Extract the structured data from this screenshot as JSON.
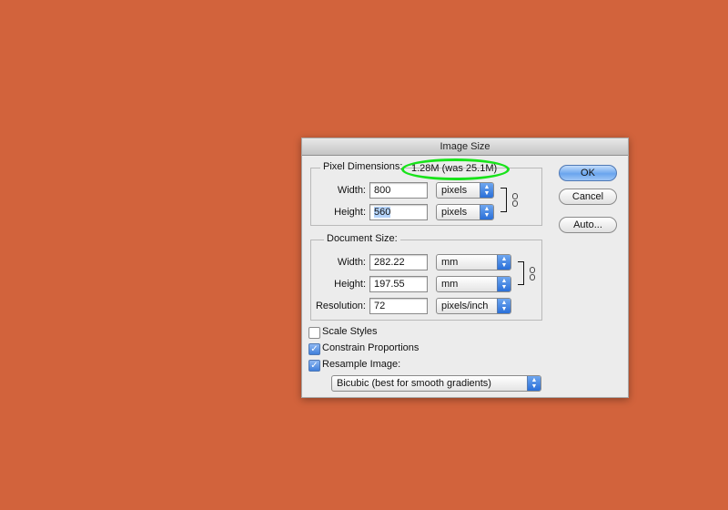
{
  "dialog": {
    "title": "Image Size"
  },
  "pixel_dimensions": {
    "legend": "Pixel Dimensions:",
    "size_text": "1.28M (was 25.1M)",
    "width_label": "Width:",
    "width_value": "800",
    "width_unit": "pixels",
    "height_label": "Height:",
    "height_value": "560",
    "height_unit": "pixels"
  },
  "document_size": {
    "legend": "Document Size:",
    "width_label": "Width:",
    "width_value": "282.22",
    "width_unit": "mm",
    "height_label": "Height:",
    "height_value": "197.55",
    "height_unit": "mm",
    "resolution_label": "Resolution:",
    "resolution_value": "72",
    "resolution_unit": "pixels/inch"
  },
  "options": {
    "scale_styles": {
      "label": "Scale Styles",
      "checked": false
    },
    "constrain_proportions": {
      "label": "Constrain Proportions",
      "checked": true
    },
    "resample_image": {
      "label": "Resample Image:",
      "checked": true
    },
    "resample_method": "Bicubic (best for smooth gradients)"
  },
  "buttons": {
    "ok": "OK",
    "cancel": "Cancel",
    "auto": "Auto..."
  },
  "colors": {
    "background": "#d2633c",
    "annotation": "#18e31a",
    "accent": "#3f7fdb"
  }
}
